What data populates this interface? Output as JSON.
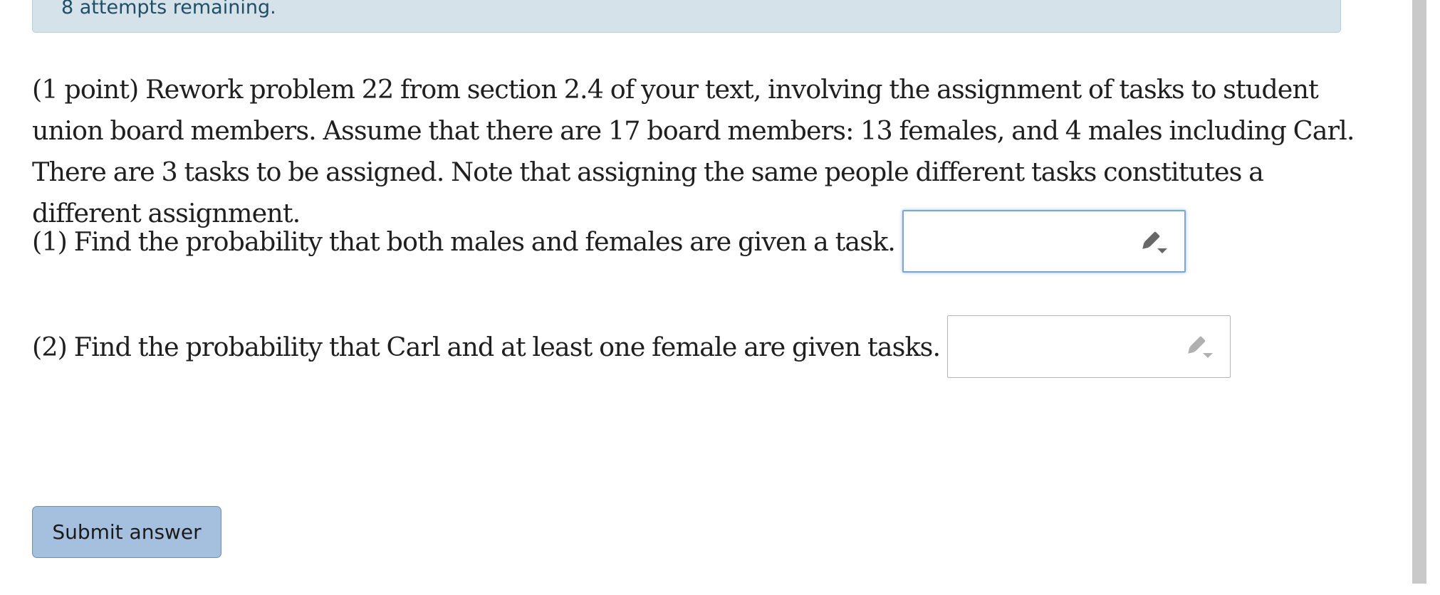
{
  "banner": {
    "text": "8 attempts remaining."
  },
  "problem": {
    "statement": "(1 point) Rework problem 22 from section 2.4 of your text, involving the assignment of tasks to student union board members. Assume that there are 17 board members: 13 females, and 4 males including Carl. There are 3 tasks to be assigned. Note that assigning the same people different tasks constitutes a different assignment."
  },
  "questions": [
    {
      "text": "(1) Find the probability that both males and females are given a task.",
      "value": "",
      "icon": "pencil-dropdown-icon",
      "focused": true
    },
    {
      "text": "(2) Find the probability that Carl and at least one female are given tasks.",
      "value": "",
      "icon": "pencil-dropdown-icon",
      "focused": false
    }
  ],
  "actions": {
    "submit_label": "Submit answer"
  },
  "colors": {
    "banner_bg": "#d6e2ea",
    "banner_text": "#1f4e66",
    "focus_border": "#7aa5d8",
    "submit_bg": "#a5bfde",
    "icon_active": "#666666",
    "icon_inactive": "#b0b0b0"
  }
}
